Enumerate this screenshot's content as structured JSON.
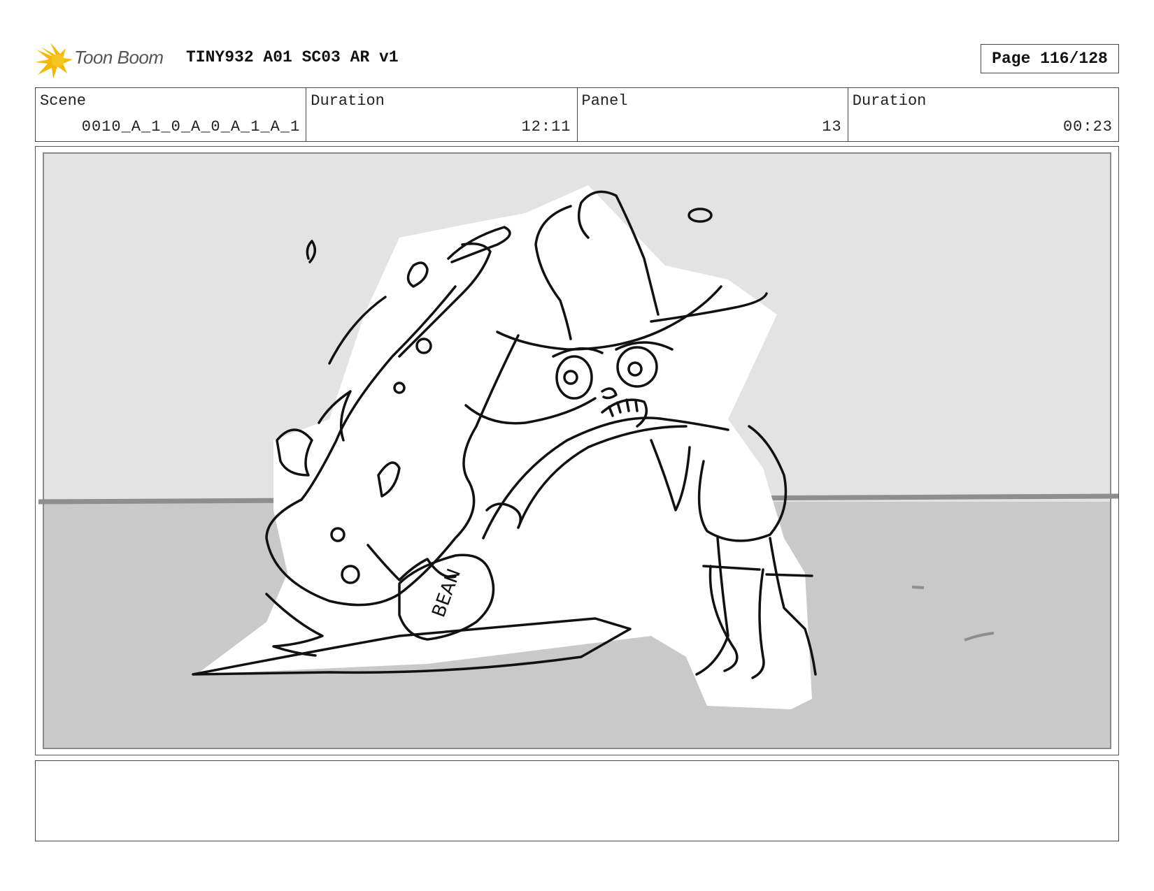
{
  "header": {
    "logo_text": "Toon Boom",
    "title": "TINY932 A01 SC03 AR v1",
    "page": "Page 116/128"
  },
  "info": {
    "scene_label": "Scene",
    "scene_value": "0010_A_1_0_A_0_A_1_A_1",
    "duration_label": "Duration",
    "duration_value": "12:11",
    "panel_label": "Panel",
    "panel_value": "13",
    "panel_duration_label": "Duration",
    "panel_duration_value": "00:23"
  },
  "panel": {
    "can_label": "BEAN"
  },
  "notes": {
    "text": ""
  },
  "colors": {
    "wall": "#e3e3e3",
    "floor": "#c9c9c9",
    "line": "#111111",
    "logo_yellow": "#f5b800"
  },
  "icons": {
    "logo": "toon-boom-logo-icon"
  }
}
